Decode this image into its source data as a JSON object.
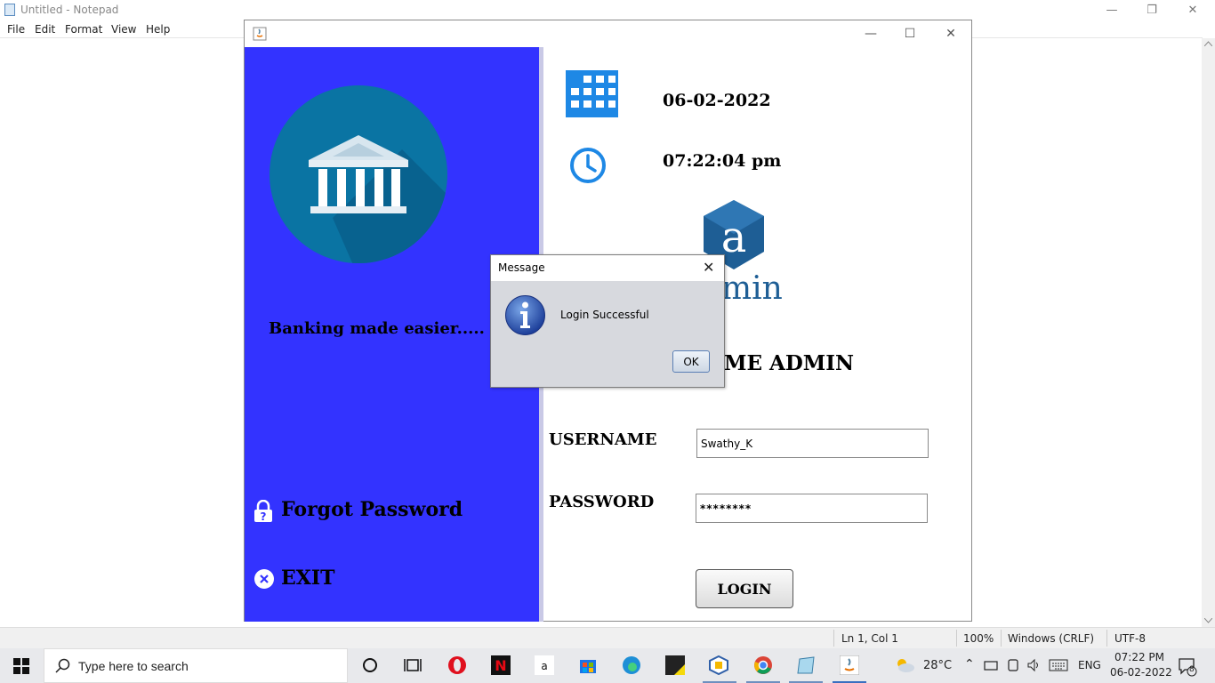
{
  "notepad": {
    "title": "Untitled - Notepad",
    "menu": [
      "File",
      "Edit",
      "Format",
      "View",
      "Help"
    ],
    "status": {
      "position": "Ln 1, Col 1",
      "zoom": "100%",
      "line_ending": "Windows (CRLF)",
      "encoding": "UTF-8"
    }
  },
  "app": {
    "slogan": "Banking made easier.....",
    "forgot_password": "Forgot Password",
    "exit": "EXIT",
    "date": "06-02-2022",
    "time": "07:22:04 pm",
    "logo_text": "min",
    "welcome_visible": "ME  ADMIN",
    "username_label": "USERNAME",
    "username_value": "Swathy_K",
    "password_label": "PASSWORD",
    "password_value": "********",
    "login_button": "LOGIN",
    "accent_color": "#3333ff"
  },
  "dialog": {
    "title": "Message",
    "message": "Login Successful",
    "ok": "OK",
    "icon": "info-icon"
  },
  "taskbar": {
    "search_placeholder": "Type here to search",
    "weather": "28°C",
    "language": "ENG",
    "time": "07:22 PM",
    "date": "06-02-2022",
    "notification_count": "8"
  }
}
